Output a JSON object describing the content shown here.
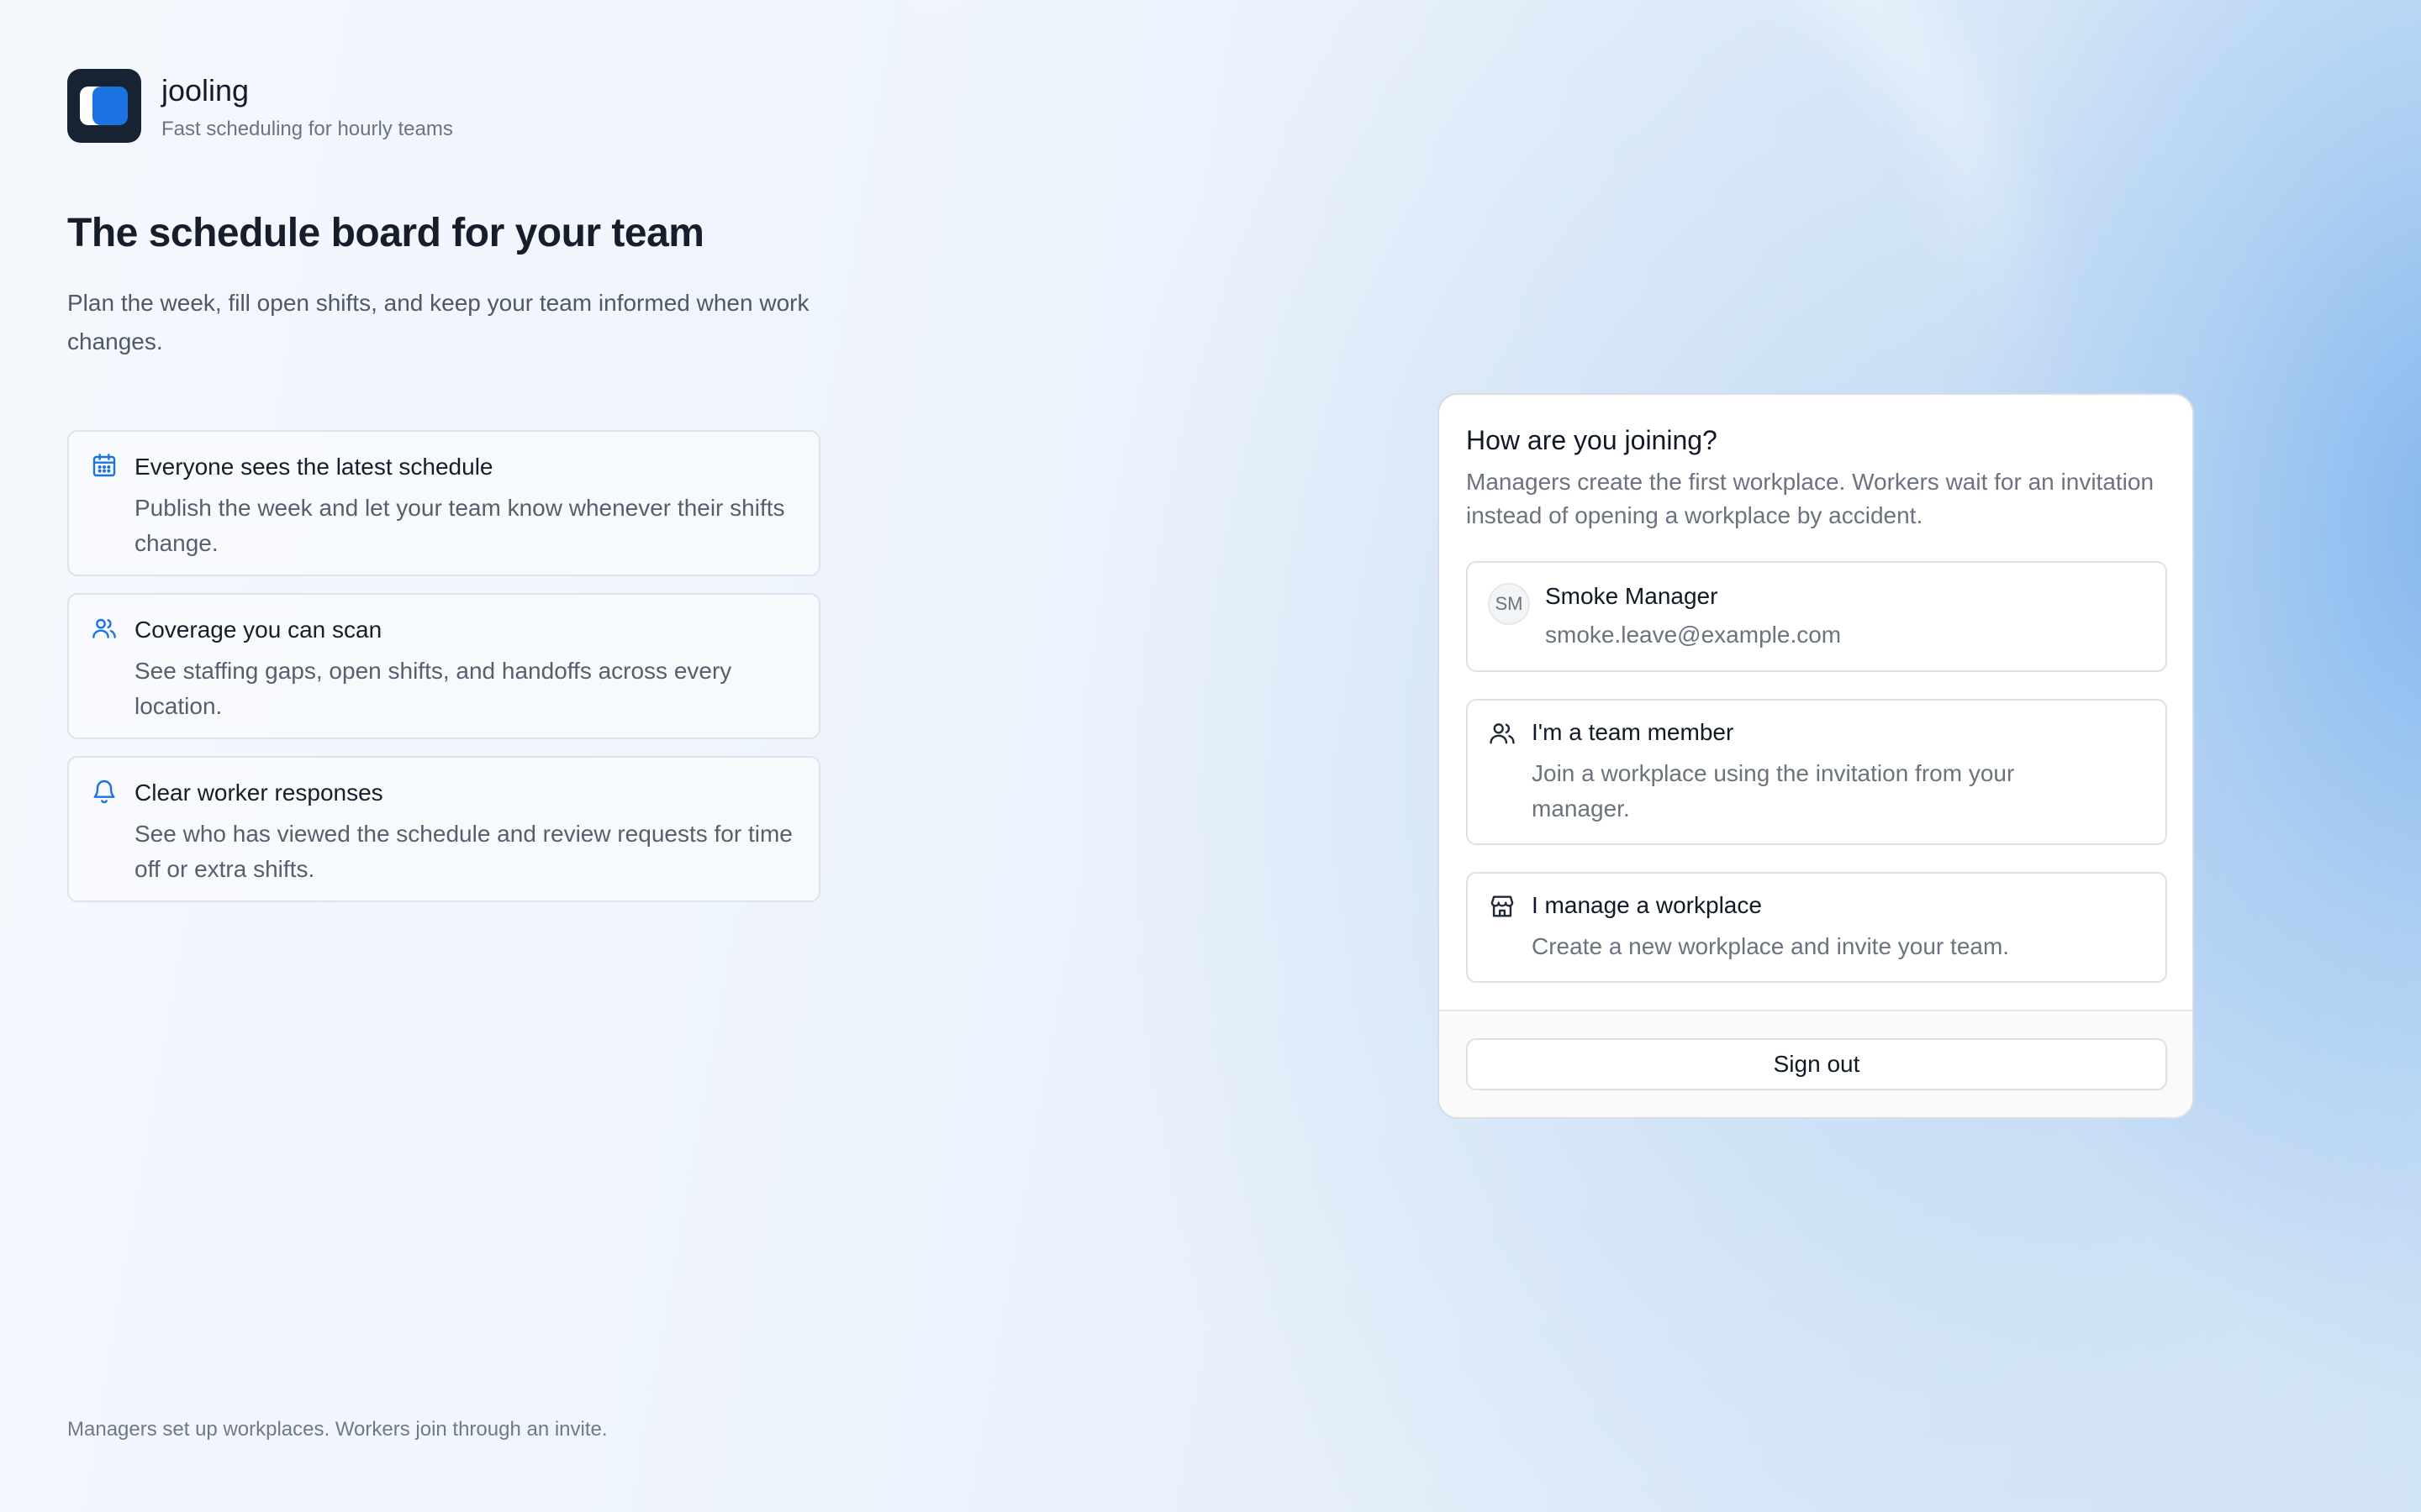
{
  "brand": {
    "name": "jooling",
    "tagline": "Fast scheduling for hourly teams"
  },
  "hero": {
    "title": "The schedule board for your team",
    "subtitle": "Plan the week, fill open shifts, and keep your team informed when work changes."
  },
  "features": [
    {
      "icon": "calendar-icon",
      "title": "Everyone sees the latest schedule",
      "description": "Publish the week and let your team know whenever their shifts change."
    },
    {
      "icon": "users-icon",
      "title": "Coverage you can scan",
      "description": "See staffing gaps, open shifts, and handoffs across every location."
    },
    {
      "icon": "bell-icon",
      "title": "Clear worker responses",
      "description": "See who has viewed the schedule and review requests for time off or extra shifts."
    }
  ],
  "footnote": "Managers set up workplaces. Workers join through an invite.",
  "join_card": {
    "title": "How are you joining?",
    "subtitle": "Managers create the first workplace. Workers wait for an invitation instead of opening a workplace by accident.",
    "account": {
      "initials": "SM",
      "name": "Smoke Manager",
      "email": "smoke.leave@example.com"
    },
    "options": [
      {
        "icon": "users-icon",
        "title": "I'm a team member",
        "description": "Join a workplace using the invitation from your manager."
      },
      {
        "icon": "store-icon",
        "title": "I manage a workplace",
        "description": "Create a new workplace and invite your team."
      }
    ],
    "sign_out_label": "Sign out"
  },
  "colors": {
    "accent": "#1a73e0",
    "logo_bg": "#172233",
    "feature_icon": "#1a73e0"
  }
}
